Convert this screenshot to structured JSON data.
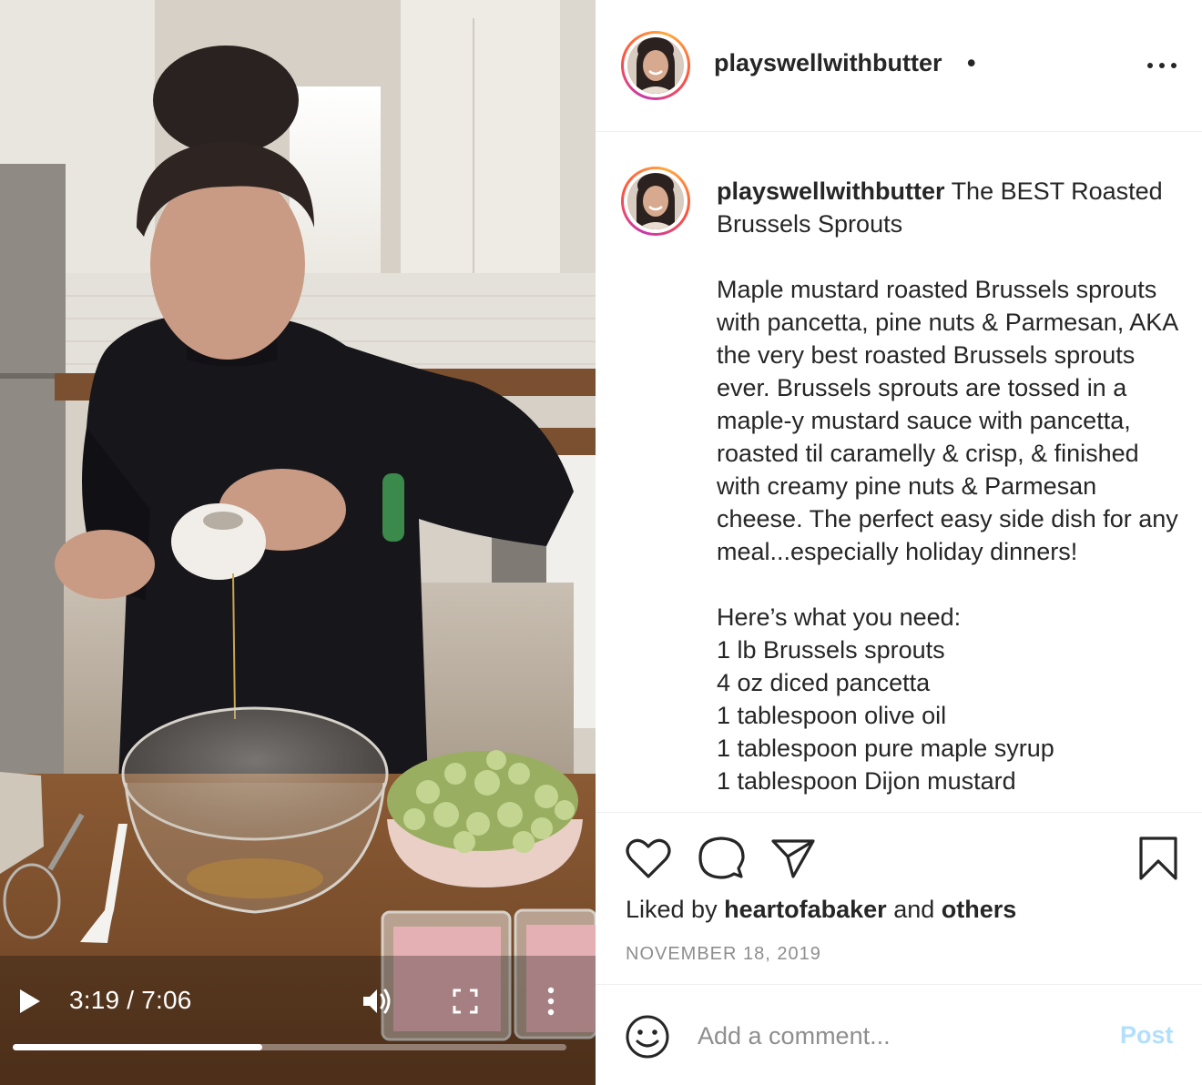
{
  "video": {
    "elapsed": "3:19",
    "duration": "7:06",
    "time_readout": "3:19 / 7:06",
    "progress": 0.451
  },
  "post": {
    "username": "playswellwithbutter",
    "header_dot": "•",
    "caption_title": "The BEST Roasted Brussels Sprouts",
    "caption_body": "Maple mustard roasted Brussels sprouts with pancetta, pine nuts & Parmesan, AKA the very best roasted Brussels sprouts ever. Brussels sprouts are tossed in a maple-y mustard sauce with pancetta, roasted til caramelly & crisp, & finished with creamy pine nuts & Parmesan cheese. The perfect easy side dish for any meal...especially holiday dinners!",
    "ingredients_heading": "Here’s what you need:",
    "ingredients": [
      "1 lb Brussels sprouts",
      "4 oz diced pancetta",
      "1 tablespoon olive oil",
      "1 tablespoon pure maple syrup",
      "1 tablespoon Dijon mustard"
    ],
    "liked_by_prefix": "Liked by",
    "liked_by_user": "heartofabaker",
    "liked_by_and": "and",
    "liked_by_others": "others",
    "date": "NOVEMBER 18, 2019"
  },
  "comment": {
    "placeholder": "Add a comment...",
    "post_label": "Post"
  },
  "icons": {
    "play": "play-icon",
    "volume": "volume-icon",
    "fullscreen": "fullscreen-icon",
    "more_video": "vertical-dots-icon",
    "more_header": "horizontal-dots-icon",
    "like": "heart-icon",
    "comment": "speech-bubble-icon",
    "share": "paper-plane-icon",
    "save": "bookmark-icon",
    "emoji": "smiley-icon"
  },
  "colors": {
    "post_button_disabled": "#b2dffc",
    "secondary_text": "#8e8e8e",
    "avatar_ring": "#c837ab"
  }
}
